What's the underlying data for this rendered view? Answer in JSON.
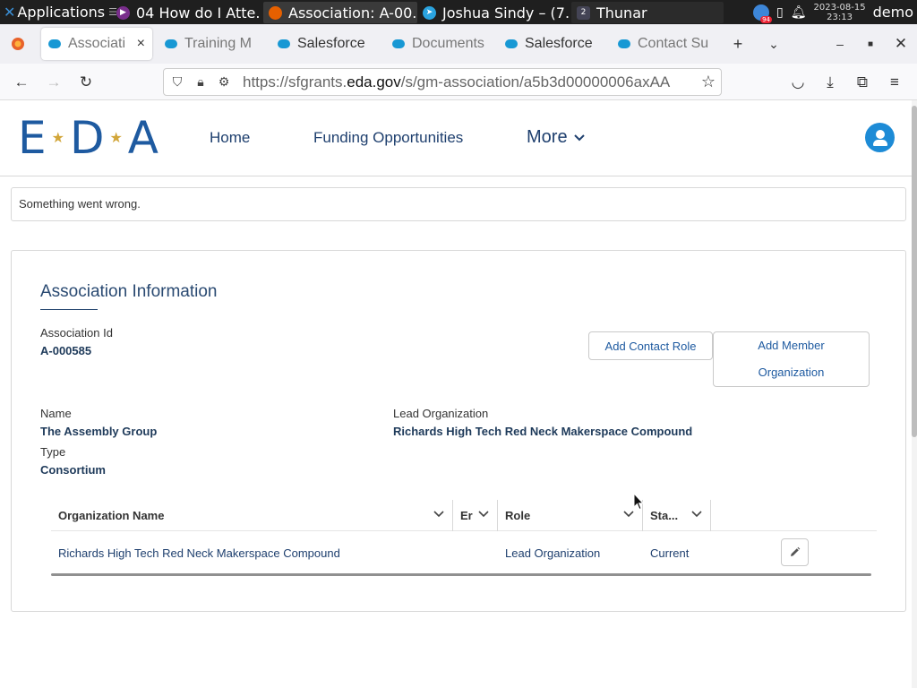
{
  "taskbar": {
    "applications_label": "Applications",
    "tasks": [
      {
        "label": "04 How do I Atte..."
      },
      {
        "label": "Association: A-00..."
      },
      {
        "label": "Joshua Sindy – (7..."
      },
      {
        "label": "Thunar"
      }
    ],
    "thunar_badge": "2",
    "tray_badge": "94",
    "clock_date": "2023-08-15",
    "clock_time": "23:13",
    "user": "demo"
  },
  "browser": {
    "tabs": [
      {
        "label": "Associati",
        "active": true
      },
      {
        "label": "Training M"
      },
      {
        "label": "Salesforce"
      },
      {
        "label": "Documents"
      },
      {
        "label": "Salesforce"
      },
      {
        "label": "Contact Su"
      }
    ],
    "url_prefix": "https://sfgrants.",
    "url_domain": "eda.gov",
    "url_suffix": "/s/gm-association/a5b3d00000006axAA"
  },
  "site": {
    "logo_letters": [
      "E",
      "D",
      "A"
    ],
    "nav": {
      "home": "Home",
      "funding": "Funding Opportunities",
      "more": "More"
    }
  },
  "error_message": "Something went wrong.",
  "association": {
    "section_title": "Association Information",
    "id_label": "Association Id",
    "id_value": "A-000585",
    "add_contact_role": "Add Contact Role",
    "add_member_line1": "Add Member",
    "add_member_line2": "Organization",
    "name_label": "Name",
    "name_value": "The Assembly Group",
    "lead_org_label": "Lead Organization",
    "lead_org_value": "Richards High Tech Red Neck Makerspace Compound",
    "type_label": "Type",
    "type_value": "Consortium"
  },
  "table": {
    "headers": {
      "org_name": "Organization Name",
      "email": "Er",
      "role": "Role",
      "status": "Sta..."
    },
    "rows": [
      {
        "org_name": "Richards High Tech Red Neck Makerspace Compound",
        "email": "",
        "role": "Lead Organization",
        "status": "Current"
      }
    ]
  },
  "colors": {
    "brand_blue": "#1e5aa0",
    "star_gold": "#d2a63a",
    "avatar_blue": "#1d8bd6"
  }
}
